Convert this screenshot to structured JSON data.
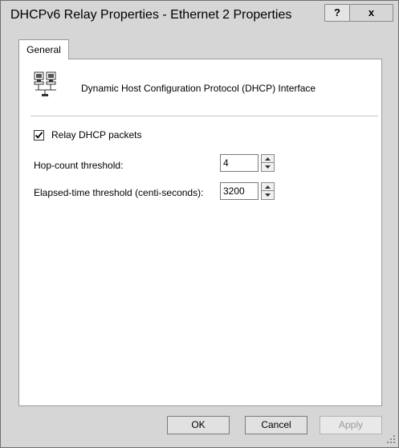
{
  "window": {
    "title": "DHCPv6 Relay Properties - Ethernet 2 Properties",
    "help_label": "?",
    "close_label": "x"
  },
  "tabs": [
    {
      "label": "General",
      "selected": true
    }
  ],
  "general": {
    "interface_label": "Dynamic Host Configuration Protocol (DHCP) Interface",
    "relay_checkbox": {
      "label": "Relay DHCP packets",
      "checked": true
    },
    "hop_count": {
      "label": "Hop-count threshold:",
      "value": "4"
    },
    "elapsed_time": {
      "label": "Elapsed-time threshold (centi-seconds):",
      "value": "3200"
    }
  },
  "buttons": {
    "ok": "OK",
    "cancel": "Cancel",
    "apply": "Apply"
  },
  "icons": {
    "interface": "network-interface-icon",
    "help": "help-icon",
    "close": "close-icon"
  }
}
